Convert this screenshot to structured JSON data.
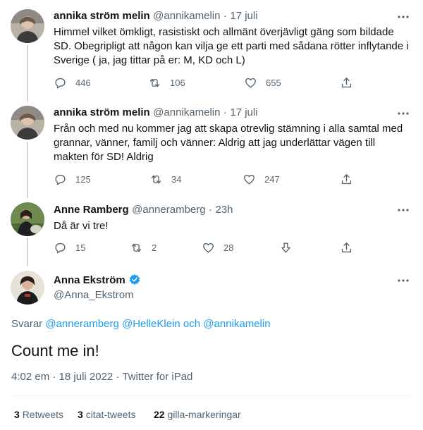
{
  "tweets": [
    {
      "name": "annika ström melin",
      "handle": "@annikamelin",
      "sep": "·",
      "date": "17 juli",
      "text": "Himmel vilket ömkligt, rasistiskt och allmänt överjävligt gäng som bildade SD. Obegripligt att någon kan vilja ge ett parti med sådana rötter inflytande i Sverige ( ja, jag tittar på er: M, KD och L)",
      "replies": "446",
      "retweets": "106",
      "likes": "655"
    },
    {
      "name": "annika ström melin",
      "handle": "@annikamelin",
      "sep": "·",
      "date": "17 juli",
      "text": "Från och med nu kommer jag att skapa otrevlig stämning i alla samtal med grannar, vänner, familj och vänner: Aldrig att jag underlättar vägen till makten för SD! Aldrig",
      "replies": "125",
      "retweets": "34",
      "likes": "247"
    },
    {
      "name": "Anne Ramberg",
      "handle": "@anneramberg",
      "sep": "·",
      "date": "23h",
      "text": "Då är vi tre!",
      "replies": "15",
      "retweets": "2",
      "likes": "28"
    }
  ],
  "main": {
    "name": "Anna Ekström",
    "handle": "@Anna_Ekstrom",
    "replying_prefix": "Svarar",
    "replying_1": "@anneramberg",
    "replying_2": "@HelleKlein",
    "replying_and": "och",
    "replying_3": "@annikamelin",
    "text": "Count me in!",
    "time": "4:02 em",
    "sep1": "·",
    "date": "18 juli 2022",
    "sep2": "·",
    "source": "Twitter for iPad"
  },
  "stats": {
    "retweets_count": "3",
    "retweets_label": "Retweets",
    "quotes_count": "3",
    "quotes_label": "citat-tweets",
    "likes_count": "22",
    "likes_label": "gilla-markeringar"
  },
  "colors": {
    "accent": "#1d9bf0",
    "text": "#0f1419",
    "secondary": "#536471",
    "verified": "#1d9bf0"
  },
  "icons": [
    "more-icon",
    "reply-icon",
    "retweet-icon",
    "like-icon",
    "share-icon",
    "dislike-icon",
    "verified-icon"
  ]
}
